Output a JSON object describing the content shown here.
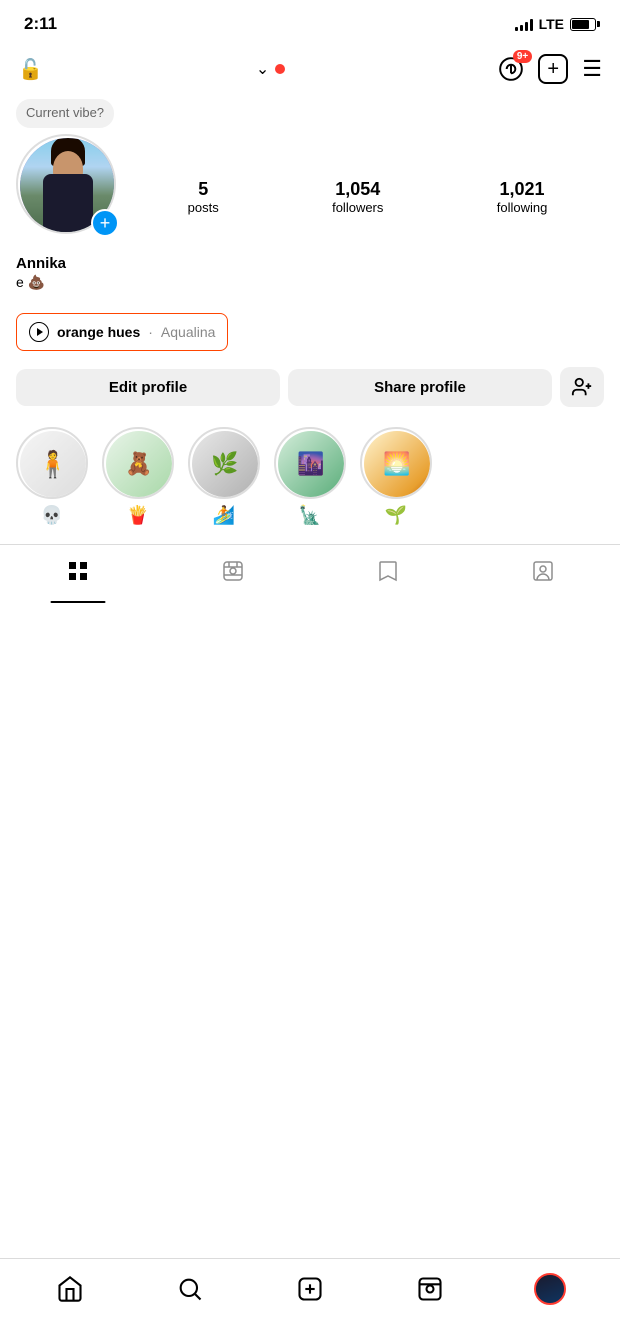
{
  "status": {
    "time": "2:11",
    "signal_bars": [
      4,
      6,
      8,
      10,
      12
    ],
    "lte": "LTE",
    "battery_percent": 75
  },
  "nav": {
    "threads_badge": "9+",
    "add_icon": "+",
    "menu_icon": "☰"
  },
  "profile": {
    "current_vibe": "Current\nvibe?",
    "username": "Annika",
    "bio": "e 💩",
    "music_title": "orange hues",
    "music_divider": "·",
    "music_artist": "Aqualina",
    "stats": {
      "posts_count": "5",
      "posts_label": "posts",
      "followers_count": "1,054",
      "followers_label": "followers",
      "following_count": "1,021",
      "following_label": "following"
    }
  },
  "buttons": {
    "edit_profile": "Edit profile",
    "share_profile": "Share profile",
    "add_friend_icon": "person+"
  },
  "highlights": [
    {
      "emoji": "💀",
      "color_class": "h1"
    },
    {
      "emoji": "🍟",
      "color_class": "h2"
    },
    {
      "emoji": "🏄",
      "color_class": "h3"
    },
    {
      "emoji": "🗽",
      "color_class": "h4"
    },
    {
      "emoji": "🌱",
      "color_class": "h5"
    }
  ],
  "tabs": [
    {
      "id": "grid",
      "active": true
    },
    {
      "id": "reels",
      "active": false
    },
    {
      "id": "saved",
      "active": false
    },
    {
      "id": "tagged",
      "active": false
    }
  ],
  "bottom_nav": {
    "items": [
      "home",
      "search",
      "add",
      "reels",
      "profile"
    ]
  }
}
